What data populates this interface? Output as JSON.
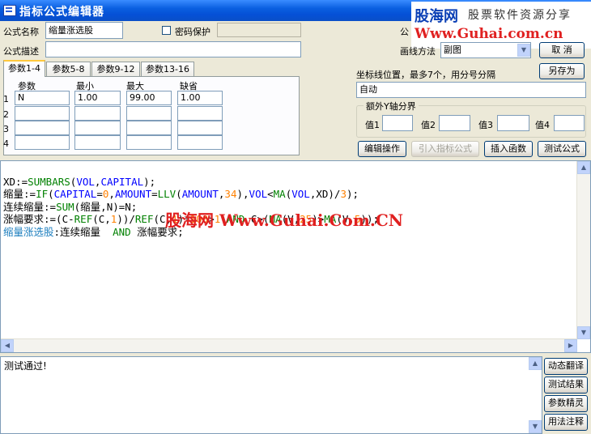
{
  "window": {
    "title": "指标公式编辑器"
  },
  "watermark_logo": {
    "brand": "股海网",
    "tagline": "股票软件资源分享",
    "url": "Www.Guhai.com.cn"
  },
  "form": {
    "name_label": "公式名称",
    "name_value": "缩量涨选股",
    "password_label": "密码保护",
    "password_checked": false,
    "type_label_partial": "公",
    "desc_label": "公式描述",
    "desc_value": "",
    "draw_method_label": "画线方法",
    "draw_method_value": "副图",
    "cancel_label": "取  消",
    "save_as_label": "另存为"
  },
  "params": {
    "tabs": [
      "参数1-4",
      "参数5-8",
      "参数9-12",
      "参数13-16"
    ],
    "active_tab": 0,
    "headers": [
      "参数",
      "最小",
      "最大",
      "缺省"
    ],
    "rows": [
      {
        "index": "1",
        "name": "N",
        "min": "1.00",
        "max": "99.00",
        "default": "1.00"
      },
      {
        "index": "2",
        "name": "",
        "min": "",
        "max": "",
        "default": ""
      },
      {
        "index": "3",
        "name": "",
        "min": "",
        "max": "",
        "default": ""
      },
      {
        "index": "4",
        "name": "",
        "min": "",
        "max": "",
        "default": ""
      }
    ]
  },
  "axis": {
    "label": "坐标线位置，最多7个，用分号分隔",
    "value": "自动",
    "group_title": "额外Y轴分界",
    "value_labels": [
      "值1",
      "值2",
      "值3",
      "值4"
    ]
  },
  "actions": {
    "edit_ops": "编辑操作",
    "import_formula": "引入指标公式",
    "insert_function": "插入函数",
    "test_formula": "测试公式"
  },
  "editor": {
    "lines": [
      "XD:=SUMBARS(VOL,CAPITAL);",
      "缩量:=IF(CAPITAL=0,AMOUNT=LLV(AMOUNT,34),VOL<MA(VOL,XD)/3);",
      "连续缩量:=SUM(缩量,N)=N;",
      "涨幅要求:=(C-REF(C,1))/REF(C,1)*100>1 AND C>(MA(V,25)>MA(V,5));",
      "缩量涨选股:连续缩量  AND 涨幅要求;"
    ],
    "overlay_watermark": "股海网 Www.Guhai.Com.CN"
  },
  "output": {
    "message": "测试通过!"
  },
  "side_buttons": [
    "动态翻译",
    "测试结果",
    "参数精灵",
    "用法注释"
  ]
}
